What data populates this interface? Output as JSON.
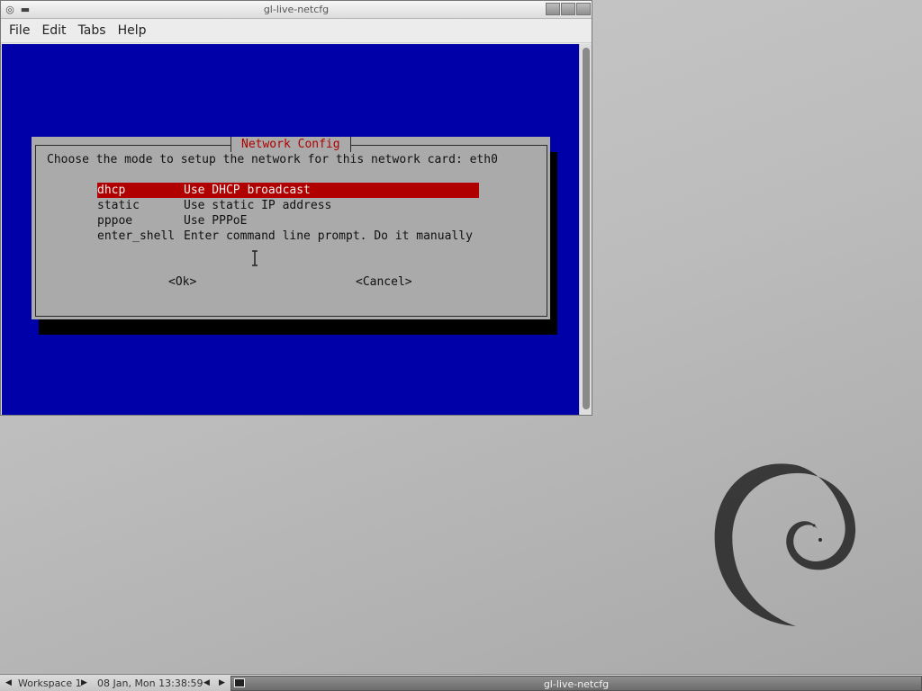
{
  "window": {
    "title": "gl-live-netcfg",
    "menu": [
      "File",
      "Edit",
      "Tabs",
      "Help"
    ]
  },
  "dialog": {
    "title": "Network Config",
    "prompt": "Choose the mode to setup the network for this network card: eth0",
    "options": [
      {
        "tag": "dhcp",
        "desc": "Use DHCP broadcast",
        "selected": true
      },
      {
        "tag": "static",
        "desc": "Use static IP address",
        "selected": false
      },
      {
        "tag": "pppoe",
        "desc": "Use PPPoE",
        "selected": false
      },
      {
        "tag": "enter_shell",
        "desc": "Enter command line prompt. Do it manually",
        "selected": false
      }
    ],
    "ok_label": "<Ok>",
    "cancel_label": "<Cancel>"
  },
  "taskbar": {
    "workspace": "Workspace 1",
    "clock": "08 Jan, Mon 13:38:59",
    "task_title": "gl-live-netcfg"
  },
  "colors": {
    "terminal_bg": "#0000a8",
    "dialog_bg": "#aaaaaa",
    "highlight": "#b00000",
    "dialog_title": "#b00000"
  },
  "icons": {
    "window_menu": "circle-menu-icon",
    "terminal": "terminal-icon",
    "desktop_logo": "debian-swirl-logo"
  }
}
